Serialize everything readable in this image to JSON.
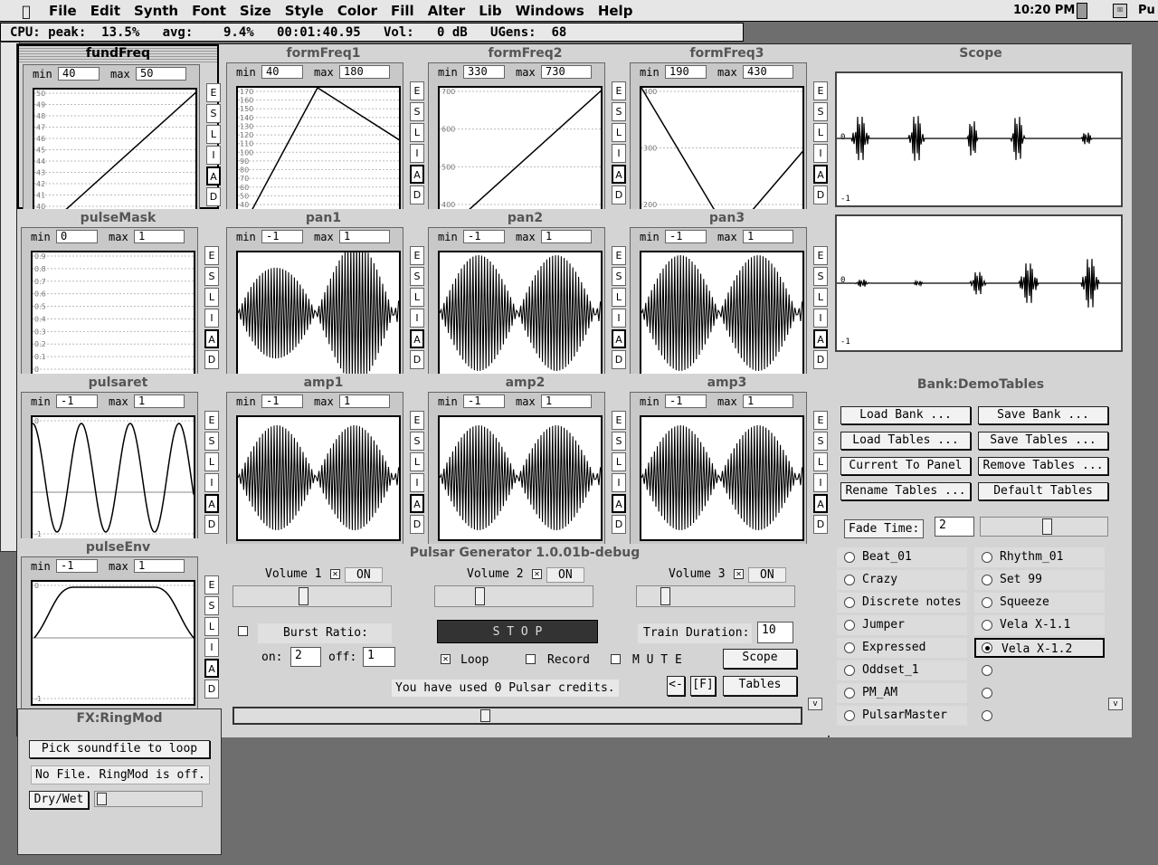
{
  "menubar": {
    "items": [
      "File",
      "Edit",
      "Synth",
      "Font",
      "Size",
      "Style",
      "Color",
      "Fill",
      "Alter",
      "Lib",
      "Windows",
      "Help"
    ],
    "clock": "10:20 PM",
    "app": "Pu"
  },
  "cpu": {
    "text": "CPU: peak:  13.5%   avg:    9.4%   00:01:40.95   Vol:   0 dB   UGens:  68"
  },
  "buttons": {
    "e": "E",
    "s": "S",
    "l": "L",
    "i": "I",
    "a": "A",
    "d": "D"
  },
  "labels": {
    "min": "min",
    "max": "max"
  },
  "tables": [
    {
      "name": "fundFreq",
      "min": "40",
      "max": "50",
      "ticks": [
        "50",
        "49",
        "48",
        "47",
        "46",
        "45",
        "44",
        "43",
        "42",
        "41",
        "40"
      ]
    },
    {
      "name": "formFreq1",
      "min": "40",
      "max": "180",
      "ticks": [
        "170",
        "160",
        "150",
        "140",
        "130",
        "120",
        "110",
        "100",
        "90",
        "80",
        "70",
        "60",
        "50",
        "40"
      ]
    },
    {
      "name": "formFreq2",
      "min": "330",
      "max": "730",
      "ticks": [
        "700",
        "600",
        "500",
        "400"
      ]
    },
    {
      "name": "formFreq3",
      "min": "190",
      "max": "430",
      "ticks": [
        "400",
        "300",
        "200"
      ]
    },
    {
      "name": "pulseMask",
      "min": "0",
      "max": "1",
      "ticks": [
        "0.9",
        "0.8",
        "0.7",
        "0.6",
        "0.5",
        "0.4",
        "0.3",
        "0.2",
        "0.1",
        "0"
      ]
    },
    {
      "name": "pan1",
      "min": "-1",
      "max": "1",
      "ticks": []
    },
    {
      "name": "pan2",
      "min": "-1",
      "max": "1",
      "ticks": []
    },
    {
      "name": "pan3",
      "min": "-1",
      "max": "1",
      "ticks": []
    },
    {
      "name": "pulsaret",
      "min": "-1",
      "max": "1",
      "ticks": [
        "0",
        "-1"
      ]
    },
    {
      "name": "amp1",
      "min": "-1",
      "max": "1",
      "ticks": []
    },
    {
      "name": "amp2",
      "min": "-1",
      "max": "1",
      "ticks": []
    },
    {
      "name": "amp3",
      "min": "-1",
      "max": "1",
      "ticks": []
    },
    {
      "name": "pulseEnv",
      "min": "-1",
      "max": "1",
      "ticks": [
        "0",
        "-1"
      ]
    }
  ],
  "scope": {
    "title": "Scope",
    "tick_zero": "0",
    "tick_neg": "-1"
  },
  "bank": {
    "title": "Bank:DemoTables",
    "buttons": [
      "Load Bank ...",
      "Save Bank ...",
      "Load Tables ...",
      "Save Tables ...",
      "Current To Panel",
      "Remove Tables ...",
      "Rename Tables ...",
      "Default Tables"
    ],
    "fade_label": "Fade Time:",
    "fade_value": "2",
    "presets_left": [
      "Beat_01",
      "Crazy",
      "Discrete notes",
      "Jumper",
      "Expressed",
      "Oddset_1",
      "PM_AM",
      "PulsarMaster"
    ],
    "presets_right": [
      "Rhythm_01",
      "Set 99",
      "Squeeze",
      "Vela X-1.1",
      "Vela X-1.2"
    ],
    "selected": "Vela X-1.2"
  },
  "generator": {
    "title": "Pulsar Generator 1.0.01b-debug",
    "volumes": [
      "Volume 1",
      "Volume 2",
      "Volume 3"
    ],
    "on": "ON",
    "burst_label": "Burst Ratio:",
    "on_label": "on:",
    "on_value": "2",
    "off_label": "off:",
    "off_value": "1",
    "stop": "S T O P",
    "loop": "Loop",
    "record": "Record",
    "mute": "M U T E",
    "train_label": "Train Duration:",
    "train_value": "10",
    "scope_btn": "Scope",
    "tables_btn": "Tables",
    "credits": "You have used 0 Pulsar credits.",
    "back": "<-",
    "f": "[F]",
    "v": "v"
  },
  "fx": {
    "title": "FX:RingMod",
    "pick": "Pick soundfile to loop",
    "status": "No File. RingMod is off.",
    "drywet": "Dry/Wet"
  }
}
